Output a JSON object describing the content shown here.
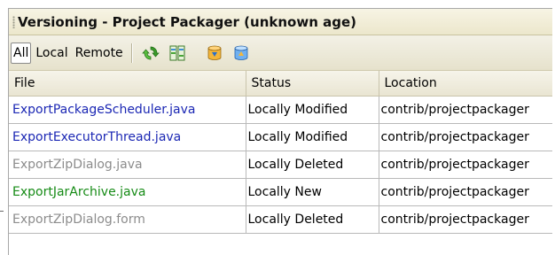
{
  "panel": {
    "title": "Versioning - Project Packager (unknown age)"
  },
  "toolbar": {
    "filters": [
      {
        "label": "All",
        "active": true
      },
      {
        "label": "Local",
        "active": false
      },
      {
        "label": "Remote",
        "active": false
      }
    ],
    "icons": [
      "refresh-icon",
      "diff-icon",
      "update-icon",
      "commit-icon"
    ]
  },
  "table": {
    "columns": [
      "File",
      "Status",
      "Location"
    ],
    "rows": [
      {
        "file": "ExportPackageScheduler.java",
        "status": "Locally Modified",
        "location": "contrib/projectpackager",
        "kind": "modified"
      },
      {
        "file": "ExportExecutorThread.java",
        "status": "Locally Modified",
        "location": "contrib/projectpackager",
        "kind": "modified"
      },
      {
        "file": "ExportZipDialog.java",
        "status": "Locally Deleted",
        "location": "contrib/projectpackager",
        "kind": "deleted"
      },
      {
        "file": "ExportJarArchive.java",
        "status": "Locally New",
        "location": "contrib/projectpackager",
        "kind": "new"
      },
      {
        "file": "ExportZipDialog.form",
        "status": "Locally Deleted",
        "location": "contrib/projectpackager",
        "kind": "deleted"
      }
    ]
  },
  "colors": {
    "modified": "#1b27b4",
    "deleted": "#8c8c8c",
    "new": "#168b16"
  }
}
